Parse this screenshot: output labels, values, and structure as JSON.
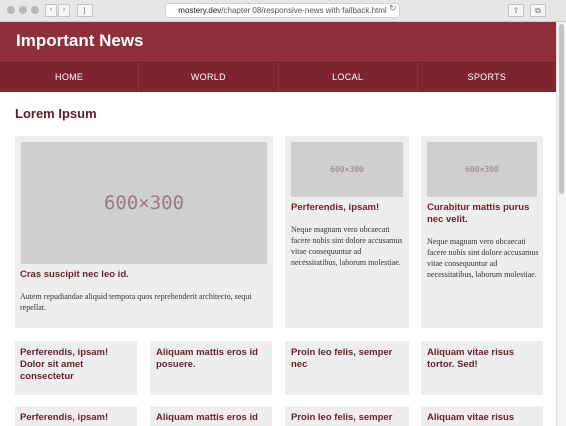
{
  "browser": {
    "url_domain": "mostery.dev",
    "url_path": "/chapter 08/responsive-news with fallback.html",
    "back_glyph": "‹",
    "forward_glyph": "›",
    "reload_glyph": "↻",
    "share_glyph": "⇪",
    "tabs_glyph": "⧉"
  },
  "site": {
    "title": "Important News",
    "nav": [
      "HOME",
      "WORLD",
      "LOCAL",
      "SPORTS"
    ],
    "section_title": "Lorem Ipsum"
  },
  "featured": [
    {
      "image_label": "600×300",
      "title": "Cras suscipit nec leo id.",
      "text": "Autem repudiandae aliquid tempora quos reprehenderit architecto, sequi repellat."
    },
    {
      "image_label": "600×300",
      "title": "Perferendis, ipsam!",
      "text": "Neque magnam vero obcaecati facere nobis sint dolore accusamus vitae consequuntur ad necessitatibus, laborum molestiae."
    },
    {
      "image_label": "600×300",
      "title": "Curabitur mattis purus nec velit.",
      "text": "Neque magnam vero obcaecati facere nobis sint dolore accusamus vitae consequuntur ad necessitatibus, laborum molestiae."
    }
  ],
  "small_row1": [
    "Perferendis, ipsam! Dolor sit amet consectetur",
    "Aliquam mattis eros id posuere.",
    "Proin leo felis, semper nec",
    "Aliquam vitae risus tortor. Sed!"
  ],
  "small_row2": [
    "Perferendis, ipsam!",
    "Aliquam mattis eros id",
    "Proin leo felis, semper",
    "Aliquam vitae risus"
  ],
  "colors": {
    "header": "#8e2f3a",
    "nav": "#7d2531",
    "title": "#6a1f2b",
    "card": "#eeeeee"
  }
}
